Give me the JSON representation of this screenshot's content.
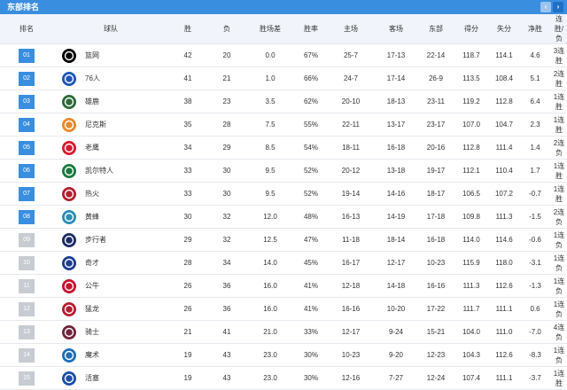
{
  "panel": {
    "title": "东部排名",
    "prev_icon": "‹",
    "next_icon": "›",
    "accent_color": "#3a8ee0",
    "inactive_rank_color": "#c7ccd2"
  },
  "columns": [
    "排名",
    "球队",
    "胜",
    "负",
    "胜场差",
    "胜率",
    "主场",
    "客场",
    "东部",
    "得分",
    "失分",
    "净胜",
    "连胜/负"
  ],
  "rows": [
    {
      "rank": "01",
      "team": "篮网",
      "logo": "nets-logo-icon",
      "logo_color": "#000000",
      "w": "42",
      "l": "20",
      "gb": "0.0",
      "pct": "67%",
      "home": "25-7",
      "away": "17-13",
      "east": "22-14",
      "pf": "118.7",
      "pa": "114.1",
      "diff": "4.6",
      "streak": "3连胜"
    },
    {
      "rank": "02",
      "team": "76人",
      "logo": "76ers-logo-icon",
      "logo_color": "#1d56b8",
      "w": "41",
      "l": "21",
      "gb": "1.0",
      "pct": "66%",
      "home": "24-7",
      "away": "17-14",
      "east": "26-9",
      "pf": "113.5",
      "pa": "108.4",
      "diff": "5.1",
      "streak": "2连胜"
    },
    {
      "rank": "03",
      "team": "雄鹿",
      "logo": "bucks-logo-icon",
      "logo_color": "#2d6a3a",
      "w": "38",
      "l": "23",
      "gb": "3.5",
      "pct": "62%",
      "home": "20-10",
      "away": "18-13",
      "east": "23-11",
      "pf": "119.2",
      "pa": "112.8",
      "diff": "6.4",
      "streak": "1连胜"
    },
    {
      "rank": "04",
      "team": "尼克斯",
      "logo": "knicks-logo-icon",
      "logo_color": "#e8892b",
      "w": "35",
      "l": "28",
      "gb": "7.5",
      "pct": "55%",
      "home": "22-11",
      "away": "13-17",
      "east": "23-17",
      "pf": "107.0",
      "pa": "104.7",
      "diff": "2.3",
      "streak": "1连胜"
    },
    {
      "rank": "05",
      "team": "老鹰",
      "logo": "hawks-logo-icon",
      "logo_color": "#d61a2e",
      "w": "34",
      "l": "29",
      "gb": "8.5",
      "pct": "54%",
      "home": "18-11",
      "away": "16-18",
      "east": "20-16",
      "pf": "112.8",
      "pa": "111.4",
      "diff": "1.4",
      "streak": "2连负"
    },
    {
      "rank": "06",
      "team": "凯尔特人",
      "logo": "celtics-logo-icon",
      "logo_color": "#1b7a3e",
      "w": "33",
      "l": "30",
      "gb": "9.5",
      "pct": "52%",
      "home": "20-12",
      "away": "13-18",
      "east": "19-17",
      "pf": "112.1",
      "pa": "110.4",
      "diff": "1.7",
      "streak": "1连胜"
    },
    {
      "rank": "07",
      "team": "热火",
      "logo": "heat-logo-icon",
      "logo_color": "#b4202e",
      "w": "33",
      "l": "30",
      "gb": "9.5",
      "pct": "52%",
      "home": "19-14",
      "away": "14-16",
      "east": "18-17",
      "pf": "106.5",
      "pa": "107.2",
      "diff": "-0.7",
      "streak": "1连胜"
    },
    {
      "rank": "08",
      "team": "黄蜂",
      "logo": "hornets-logo-icon",
      "logo_color": "#2a8fb6",
      "w": "30",
      "l": "32",
      "gb": "12.0",
      "pct": "48%",
      "home": "16-13",
      "away": "14-19",
      "east": "17-18",
      "pf": "109.8",
      "pa": "111.3",
      "diff": "-1.5",
      "streak": "2连负"
    },
    {
      "rank": "09",
      "team": "步行者",
      "logo": "pacers-logo-icon",
      "logo_color": "#1b2c66",
      "w": "29",
      "l": "32",
      "gb": "12.5",
      "pct": "47%",
      "home": "11-18",
      "away": "18-14",
      "east": "16-18",
      "pf": "114.0",
      "pa": "114.6",
      "diff": "-0.6",
      "streak": "1连负"
    },
    {
      "rank": "10",
      "team": "奇才",
      "logo": "wizards-logo-icon",
      "logo_color": "#1c3f8f",
      "w": "28",
      "l": "34",
      "gb": "14.0",
      "pct": "45%",
      "home": "16-17",
      "away": "12-17",
      "east": "10-23",
      "pf": "115.9",
      "pa": "118.0",
      "diff": "-3.1",
      "streak": "1连负"
    },
    {
      "rank": "11",
      "team": "公牛",
      "logo": "bulls-logo-icon",
      "logo_color": "#c8102e",
      "w": "26",
      "l": "36",
      "gb": "16.0",
      "pct": "41%",
      "home": "12-18",
      "away": "14-18",
      "east": "16-16",
      "pf": "111.3",
      "pa": "112.6",
      "diff": "-1.3",
      "streak": "1连负"
    },
    {
      "rank": "12",
      "team": "猛龙",
      "logo": "raptors-logo-icon",
      "logo_color": "#b51f2e",
      "w": "26",
      "l": "36",
      "gb": "16.0",
      "pct": "41%",
      "home": "16-16",
      "away": "10-20",
      "east": "17-22",
      "pf": "111.7",
      "pa": "111.1",
      "diff": "0.6",
      "streak": "1连负"
    },
    {
      "rank": "13",
      "team": "骑士",
      "logo": "cavaliers-logo-icon",
      "logo_color": "#6f263d",
      "w": "21",
      "l": "41",
      "gb": "21.0",
      "pct": "33%",
      "home": "12-17",
      "away": "9-24",
      "east": "15-21",
      "pf": "104.0",
      "pa": "111.0",
      "diff": "-7.0",
      "streak": "4连负"
    },
    {
      "rank": "14",
      "team": "魔术",
      "logo": "magic-logo-icon",
      "logo_color": "#1f6fb6",
      "w": "19",
      "l": "43",
      "gb": "23.0",
      "pct": "30%",
      "home": "10-23",
      "away": "9-20",
      "east": "12-23",
      "pf": "104.3",
      "pa": "112.6",
      "diff": "-8.3",
      "streak": "1连负"
    },
    {
      "rank": "15",
      "team": "活塞",
      "logo": "pistons-logo-icon",
      "logo_color": "#1d4fa8",
      "w": "19",
      "l": "43",
      "gb": "23.0",
      "pct": "30%",
      "home": "12-16",
      "away": "7-27",
      "east": "12-24",
      "pf": "107.4",
      "pa": "111.1",
      "diff": "-3.7",
      "streak": "1连胜"
    }
  ]
}
